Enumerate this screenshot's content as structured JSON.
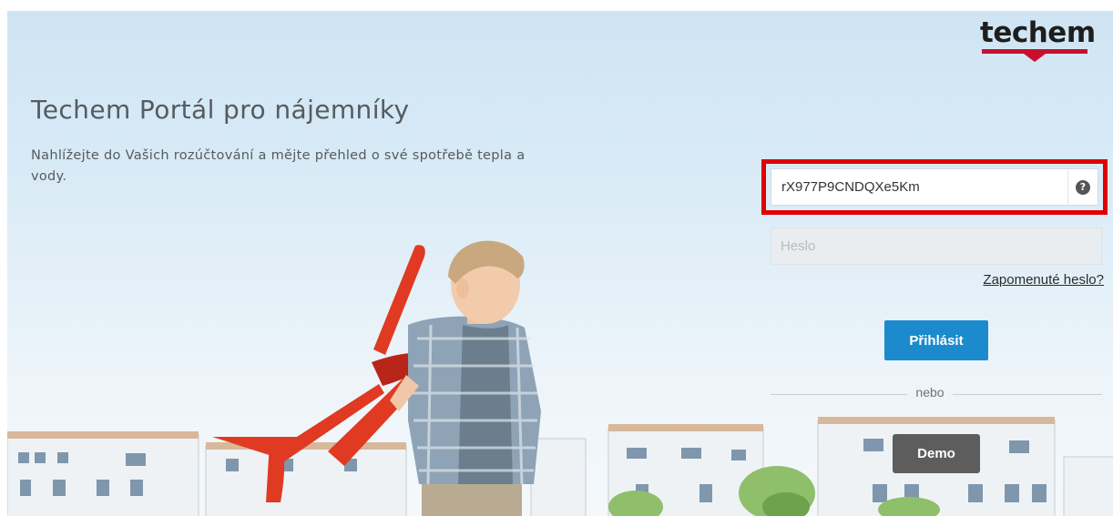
{
  "brand": {
    "logo_text": "techem"
  },
  "hero": {
    "title": "Techem Portál pro nájemníky",
    "subtitle": "Nahlížejte do Vašich rozúčtování a mějte přehled o své spotřebě tepla a vody."
  },
  "login": {
    "username_value": "rX977P9CNDQXe5Km",
    "help_symbol": "?",
    "password_placeholder": "Heslo",
    "forgot_password_label": "Zapomenuté heslo?",
    "submit_label": "Přihlásit",
    "or_label": "nebo",
    "demo_label": "Demo"
  },
  "colors": {
    "brand_red": "#c8102e",
    "primary_button": "#1b8bcd",
    "demo_button": "#5d5d5d",
    "highlight": "#e00000"
  }
}
